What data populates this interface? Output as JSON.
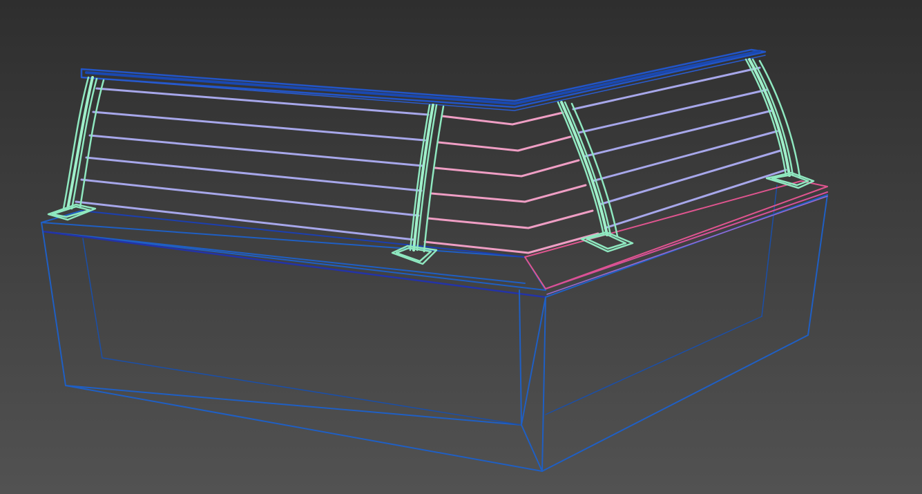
{
  "viewport": {
    "background_top": "#2e2e2e",
    "background_bottom": "#525252",
    "objects": [
      {
        "name": "base-block",
        "color": "#1f5fc4"
      },
      {
        "name": "top-rail",
        "color": "#2255c8"
      },
      {
        "name": "posts",
        "color": "#8fe8c0"
      },
      {
        "name": "cables-left",
        "color": "#a7a7ea"
      },
      {
        "name": "cables-corner",
        "color": "#ef9ec4"
      },
      {
        "name": "cables-right",
        "color": "#a7a7ea"
      },
      {
        "name": "cap-right",
        "color": "#e0558f"
      }
    ]
  }
}
